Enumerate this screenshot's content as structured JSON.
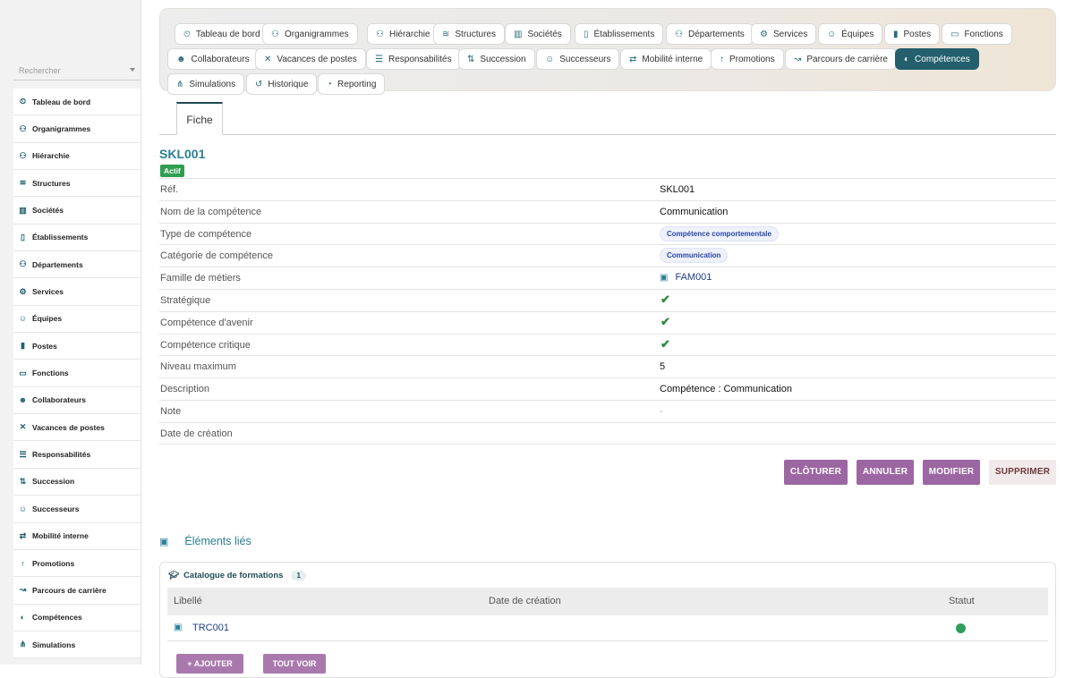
{
  "sidebar": {
    "search_placeholder": "Rechercher",
    "items": [
      {
        "label": "Tableau de bord",
        "icon": "⏲"
      },
      {
        "label": "Organigrammes",
        "icon": "⚇"
      },
      {
        "label": "Hiérarchie",
        "icon": "⚇"
      },
      {
        "label": "Structures",
        "icon": "≋"
      },
      {
        "label": "Sociétés",
        "icon": "▥"
      },
      {
        "label": "Établissements",
        "icon": "▯"
      },
      {
        "label": "Départements",
        "icon": "⚇"
      },
      {
        "label": "Services",
        "icon": "⚙"
      },
      {
        "label": "Équipes",
        "icon": "☺"
      },
      {
        "label": "Postes",
        "icon": "▮"
      },
      {
        "label": "Fonctions",
        "icon": "▭"
      },
      {
        "label": "Collaborateurs",
        "icon": "☻"
      },
      {
        "label": "Vacances de postes",
        "icon": "✕"
      },
      {
        "label": "Responsabilités",
        "icon": "☰"
      },
      {
        "label": "Succession",
        "icon": "⇅"
      },
      {
        "label": "Successeurs",
        "icon": "☺"
      },
      {
        "label": "Mobilité interne",
        "icon": "⇄"
      },
      {
        "label": "Promotions",
        "icon": "↑"
      },
      {
        "label": "Parcours de carrière",
        "icon": "↝"
      },
      {
        "label": "Compétences",
        "icon": "◐"
      },
      {
        "label": "Simulations",
        "icon": "⋔"
      }
    ]
  },
  "topnav": {
    "items": [
      {
        "label": "Tableau de bord",
        "icon": "⏲"
      },
      {
        "label": "Organigrammes",
        "icon": "⚇"
      },
      {
        "label": "Hiérarchie",
        "icon": "⚇"
      },
      {
        "label": "Structures",
        "icon": "≋"
      },
      {
        "label": "Sociétés",
        "icon": "▥"
      },
      {
        "label": "Établissements",
        "icon": "▯"
      },
      {
        "label": "Départements",
        "icon": "⚇"
      },
      {
        "label": "Services",
        "icon": "⚙"
      },
      {
        "label": "Équipes",
        "icon": "☺"
      },
      {
        "label": "Postes",
        "icon": "▮"
      },
      {
        "label": "Fonctions",
        "icon": "▭"
      },
      {
        "label": "Collaborateurs",
        "icon": "☻"
      },
      {
        "label": "Vacances de postes",
        "icon": "✕"
      },
      {
        "label": "Responsabilités",
        "icon": "☰"
      },
      {
        "label": "Succession",
        "icon": "⇅"
      },
      {
        "label": "Successeurs",
        "icon": "☺"
      },
      {
        "label": "Mobilité interne",
        "icon": "⇄"
      },
      {
        "label": "Promotions",
        "icon": "↑"
      },
      {
        "label": "Parcours de carrière",
        "icon": "↝"
      },
      {
        "label": "Compétences",
        "icon": "◐",
        "active": true
      },
      {
        "label": "Simulations",
        "icon": "⋔"
      },
      {
        "label": "Historique",
        "icon": "↺"
      },
      {
        "label": "Reporting",
        "icon": "◔"
      }
    ]
  },
  "tab": {
    "label": "Fiche"
  },
  "record": {
    "code": "SKL001",
    "status": "Actif",
    "fields": {
      "ref": {
        "label": "Réf.",
        "value": "SKL001"
      },
      "name": {
        "label": "Nom de la compétence",
        "value": "Communication"
      },
      "type": {
        "label": "Type de compétence",
        "value": "Compétence comportementale"
      },
      "category": {
        "label": "Catégorie de compétence",
        "value": "Communication"
      },
      "family": {
        "label": "Famille de métiers",
        "value": "FAM001"
      },
      "strategic": {
        "label": "Stratégique",
        "value": "✔"
      },
      "future": {
        "label": "Compétence d'avenir",
        "value": "✔"
      },
      "critical": {
        "label": "Compétence critique",
        "value": "✔"
      },
      "max_level": {
        "label": "Niveau maximum",
        "value": "5"
      },
      "description": {
        "label": "Description",
        "value": "Compétence : Communication"
      },
      "note": {
        "label": "Note",
        "value": "-"
      },
      "created": {
        "label": "Date de création",
        "value": ""
      }
    }
  },
  "actions": {
    "close": "CLÔTURER",
    "cancel": "ANNULER",
    "edit": "MODIFIER",
    "delete": "SUPPRIMER"
  },
  "linked": {
    "title": "Éléments liés",
    "catalog": {
      "title": "Catalogue de formations",
      "count": "1",
      "columns": [
        "Libellé",
        "Date de création",
        "Statut"
      ],
      "rows": [
        {
          "label": "TRC001",
          "date": "",
          "status_color": "#2e9e5a"
        }
      ],
      "add_label": "+ AJOUTER",
      "see_all_label": "TOUT VOIR"
    }
  },
  "colors": {
    "accent": "#235f6c",
    "action": "#9c66a2",
    "success": "#2f9e50"
  }
}
